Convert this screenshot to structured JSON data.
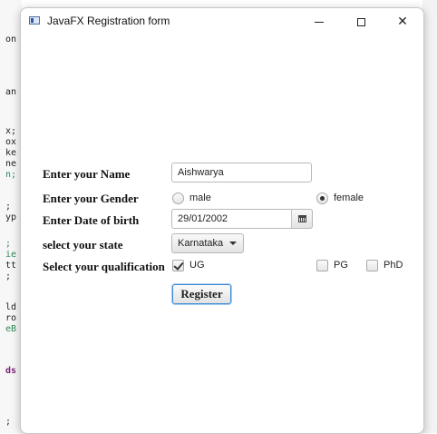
{
  "background_editor": {
    "fragments": [
      "on",
      "an",
      "x;",
      "ox",
      "ke",
      "ne",
      "n;",
      ";",
      "yp",
      ";",
      "ie",
      "tt",
      ";",
      "ld",
      "ro",
      "eB",
      "ds",
      ";"
    ]
  },
  "window": {
    "title": "JavaFX Registration form",
    "controls": {
      "minimize": "minimize-icon",
      "maximize": "maximize-icon",
      "close": "✕"
    }
  },
  "form": {
    "name": {
      "label": "Enter your Name",
      "value": "Aishwarya"
    },
    "gender": {
      "label": "Enter your Gender",
      "options": [
        {
          "label": "male",
          "selected": false
        },
        {
          "label": "female",
          "selected": true
        }
      ]
    },
    "dob": {
      "label": "Enter Date of birth",
      "value": "29/01/2002",
      "icon": "calendar-icon"
    },
    "state": {
      "label": "select your state",
      "value": "Karnataka",
      "icon": "chevron-down-icon"
    },
    "qualification": {
      "label": "Select your qualification",
      "options": [
        {
          "label": "UG",
          "checked": true
        },
        {
          "label": "PG",
          "checked": false
        },
        {
          "label": "PhD",
          "checked": false
        }
      ]
    },
    "register_label": "Register"
  },
  "colors": {
    "focus_accent": "#3d8bd6",
    "window_bg": "#ffffff"
  }
}
